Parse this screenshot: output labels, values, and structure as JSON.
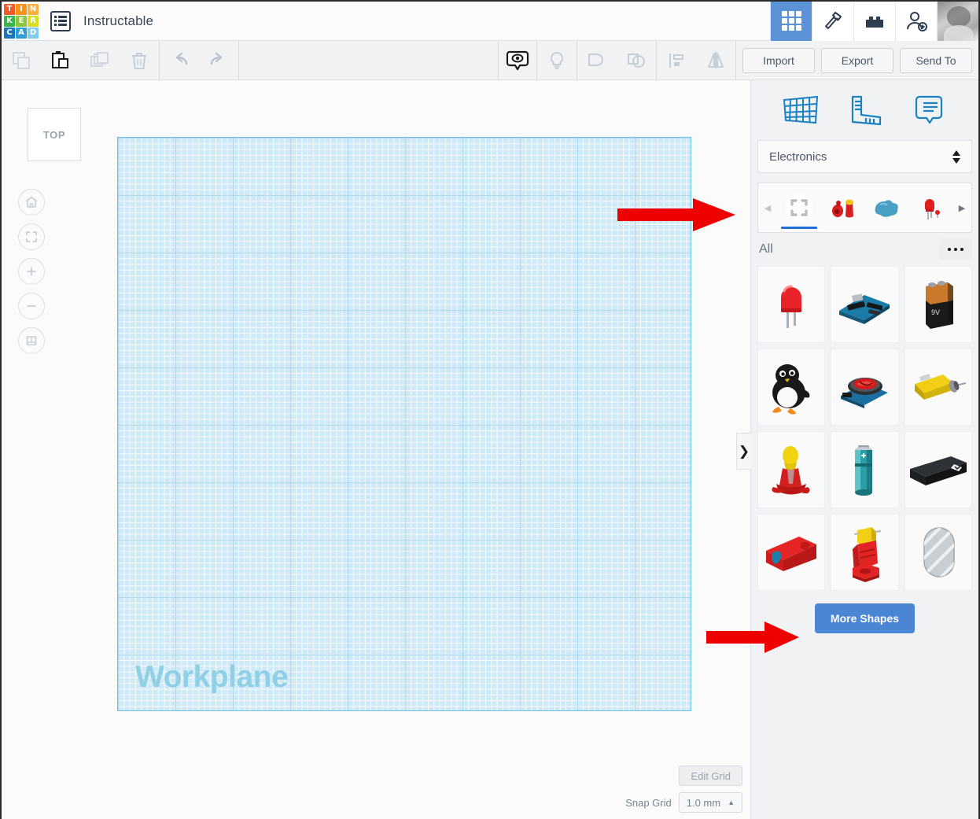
{
  "app": {
    "brand_letters": [
      "T",
      "I",
      "N",
      "K",
      "E",
      "R",
      "C",
      "A",
      "D"
    ],
    "brand_colors": [
      "#f15a29",
      "#f7941e",
      "#fbb040",
      "#39b54a",
      "#8cc63f",
      "#d7df23",
      "#1b75bc",
      "#2e9fd4",
      "#7ecdf0"
    ],
    "document_title": "Instructable"
  },
  "topbar": {
    "buttons": [
      {
        "name": "grid-view",
        "icon": "grid-icon",
        "active": true
      },
      {
        "name": "design-tools",
        "icon": "hammer-icon",
        "active": false
      },
      {
        "name": "blocks",
        "icon": "lego-brick-icon",
        "active": false
      },
      {
        "name": "invite-user",
        "icon": "add-user-icon",
        "active": false
      }
    ],
    "avatar_label": "user-avatar"
  },
  "toolbar": {
    "left_tools": [
      {
        "name": "copy-button",
        "icon": "copy-icon",
        "enabled": false
      },
      {
        "name": "paste-button",
        "icon": "clipboard-icon",
        "enabled": true
      },
      {
        "name": "duplicate-button",
        "icon": "duplicate-icon",
        "enabled": false
      },
      {
        "name": "delete-button",
        "icon": "trash-icon",
        "enabled": false
      },
      {
        "name": "undo-button",
        "icon": "undo-arrow-icon",
        "enabled": false
      },
      {
        "name": "redo-button",
        "icon": "redo-arrow-icon",
        "enabled": false
      }
    ],
    "center_tools": [
      {
        "name": "show-hide-button",
        "icon": "eye-bubble-icon",
        "enabled": true
      },
      {
        "name": "note-button",
        "icon": "lightbulb-icon",
        "enabled": false
      },
      {
        "name": "group-button",
        "icon": "group-shapes-icon",
        "enabled": false
      },
      {
        "name": "ungroup-button",
        "icon": "ungroup-shapes-icon",
        "enabled": false
      },
      {
        "name": "align-button",
        "icon": "align-icon",
        "enabled": false
      },
      {
        "name": "mirror-button",
        "icon": "mirror-icon",
        "enabled": false
      }
    ],
    "import_label": "Import",
    "export_label": "Export",
    "send_to_label": "Send To"
  },
  "canvas": {
    "view_cube_label": "TOP",
    "nav_buttons": [
      {
        "name": "home-view-button",
        "icon": "home-icon"
      },
      {
        "name": "fit-to-view-button",
        "icon": "fit-frame-icon"
      },
      {
        "name": "zoom-in-button",
        "icon": "plus-icon"
      },
      {
        "name": "zoom-out-button",
        "icon": "minus-icon"
      },
      {
        "name": "perspective-toggle-button",
        "icon": "perspective-box-icon"
      }
    ],
    "workplane_label": "Workplane",
    "edit_grid_label": "Edit Grid",
    "snap_grid_label": "Snap Grid",
    "snap_grid_value": "1.0 mm",
    "snap_grid_caret": "▲"
  },
  "panel": {
    "top_icons": [
      {
        "name": "workplane-tool-icon",
        "icon": "workplane-grid-icon"
      },
      {
        "name": "ruler-tool-icon",
        "icon": "ruler-icon"
      },
      {
        "name": "notes-tool-icon",
        "icon": "note-bubble-icon"
      }
    ],
    "accent_color": "#1b82c1",
    "category_value": "Electronics",
    "tab_prev": "◀",
    "tab_next": "▶",
    "tabs": [
      {
        "name": "tab-all",
        "icon": "select-frame-icon",
        "active": true
      },
      {
        "name": "tab-starters",
        "icon": "red-parts-icon",
        "active": false
      },
      {
        "name": "tab-connections",
        "icon": "blue-blob-icon",
        "active": false
      },
      {
        "name": "tab-components",
        "icon": "red-led-icon",
        "active": false
      }
    ],
    "section_label": "All",
    "more_menu_label": "···",
    "shapes": [
      {
        "name": "shape-led",
        "label": "LED"
      },
      {
        "name": "shape-arduino",
        "label": "Arduino Board"
      },
      {
        "name": "shape-9v-battery",
        "label": "9V Battery"
      },
      {
        "name": "shape-penguin",
        "label": "Penguin"
      },
      {
        "name": "shape-fan-module",
        "label": "Fan Module"
      },
      {
        "name": "shape-dc-motor",
        "label": "DC Motor"
      },
      {
        "name": "shape-bulb-holder",
        "label": "Bulb Holder"
      },
      {
        "name": "shape-aa-battery",
        "label": "AA Battery"
      },
      {
        "name": "shape-battery-pack",
        "label": "Battery Pack"
      },
      {
        "name": "shape-red-module",
        "label": "Red Module"
      },
      {
        "name": "shape-connector",
        "label": "Connector"
      },
      {
        "name": "shape-disc",
        "label": "Disc"
      }
    ],
    "more_shapes_label": "More Shapes",
    "collapse_handle_glyph": "❯"
  },
  "annotations": {
    "color": "#ee0000",
    "arrows": [
      {
        "name": "annotation-arrow-tabstrip",
        "points_to": "panel category tab strip"
      },
      {
        "name": "annotation-arrow-more-shapes",
        "points_to": "More Shapes button"
      }
    ]
  }
}
